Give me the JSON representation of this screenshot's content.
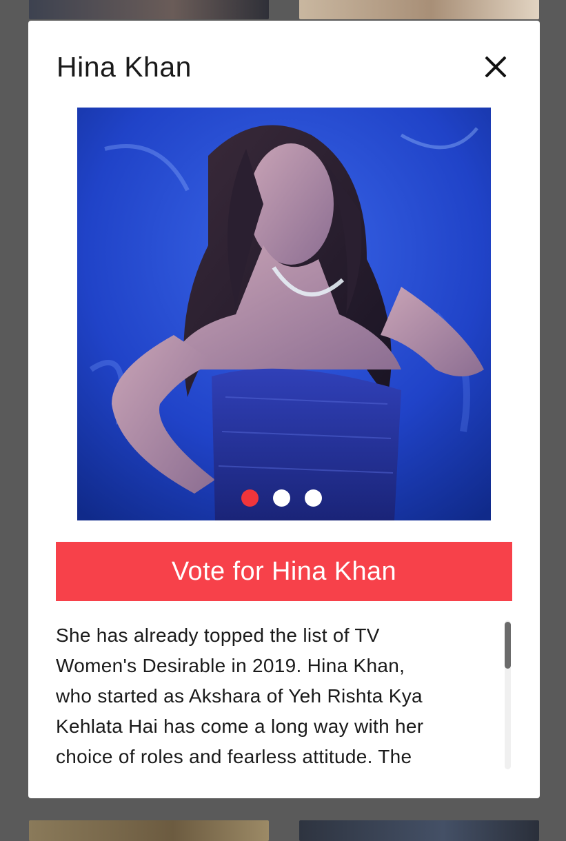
{
  "modal": {
    "title": "Hina Khan",
    "close_icon": "close-icon"
  },
  "carousel": {
    "slide_count": 3,
    "active_index": 0,
    "colors": {
      "active_dot": "#f0353b",
      "inactive_dot": "#ffffff",
      "backdrop": "#1f36b8"
    }
  },
  "vote": {
    "label": "Vote for Hina Khan",
    "color": "#f7414a"
  },
  "description": {
    "lines": [
      "She has already topped the list of TV",
      "Women's Desirable in 2019. Hina Khan,",
      "who started as Akshara of Yeh Rishta Kya",
      "Kehlata Hai has come a long way with her",
      "choice of roles and fearless attitude. The"
    ]
  }
}
